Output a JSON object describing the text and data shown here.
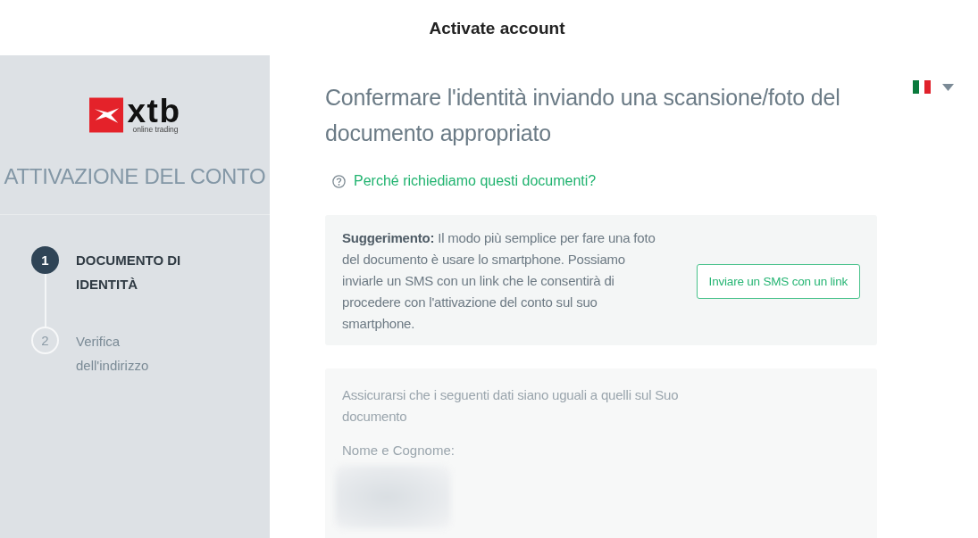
{
  "window": {
    "title": "Activate account"
  },
  "sidebar": {
    "logo": {
      "wordmark": "xtb",
      "tagline": "online trading"
    },
    "heading": "ATTIVAZIONE DEL CONTO",
    "steps": [
      {
        "number": "1",
        "label": "DOCUMENTO DI IDENTITÀ",
        "selected": true
      },
      {
        "number": "2",
        "label": "Verifica dell'indirizzo",
        "selected": false
      }
    ]
  },
  "main": {
    "title": "Confermare l'identità inviando una scansione/foto del documento appropriato",
    "help_link": "Perché richiediamo questi documenti?",
    "tip": {
      "text": "**Suggerimento:** Il modo più semplice per fare una foto del documento è usare lo smartphone. Possiamo inviarle un SMS con un link che le consentirà di procedere con l'attivazione del conto sul suo smartphone.",
      "button": "Inviare un SMS con un link"
    },
    "details": {
      "intro": "Assicurarsi che i seguenti dati siano uguali a quelli sul Suo documento",
      "name_field": {
        "label": "Nome e Cognome:"
      }
    }
  }
}
